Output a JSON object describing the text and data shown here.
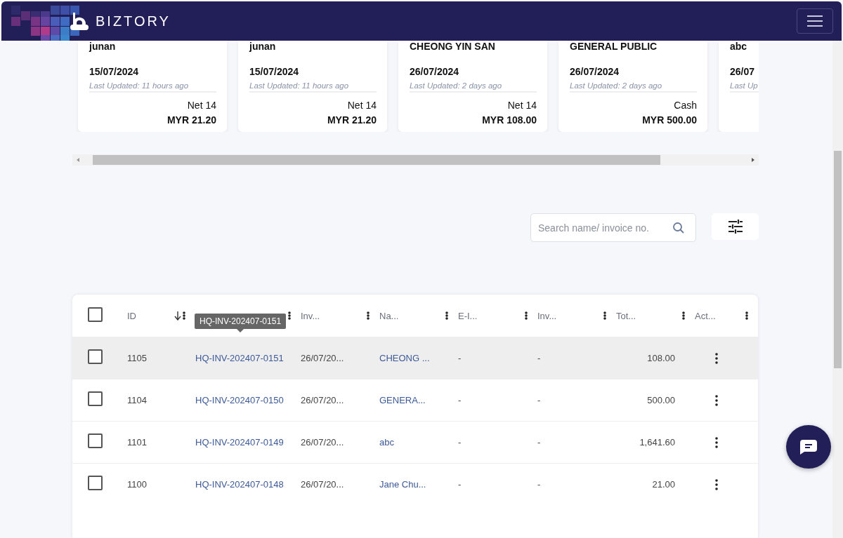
{
  "header": {
    "brand": "BIZTORY"
  },
  "cards": [
    {
      "name": "junan",
      "date": "15/07/2024",
      "updated": "Last Updated: 11 hours ago",
      "terms": "Net 14",
      "amount": "MYR 21.20"
    },
    {
      "name": "junan",
      "date": "15/07/2024",
      "updated": "Last Updated: 11 hours ago",
      "terms": "Net 14",
      "amount": "MYR 21.20"
    },
    {
      "name": "CHEONG YIN SAN",
      "date": "26/07/2024",
      "updated": "Last Updated: 2 days ago",
      "terms": "Net 14",
      "amount": "MYR 108.00"
    },
    {
      "name": "GENERAL PUBLIC",
      "date": "26/07/2024",
      "updated": "Last Updated: 2 days ago",
      "terms": "Cash",
      "amount": "MYR 500.00"
    },
    {
      "name": "abc",
      "date": "26/07",
      "updated": "Last Up"
    }
  ],
  "search": {
    "placeholder": "Search name/ invoice no."
  },
  "table": {
    "all_checked": false,
    "columns": [
      {
        "label": "ID",
        "kind": "sorted"
      },
      {
        "kind": "plain"
      },
      {
        "label": "Inv...",
        "kind": "plain"
      },
      {
        "label": "Na...",
        "kind": "plain"
      },
      {
        "label": "E-I...",
        "kind": "plain"
      },
      {
        "label": "Inv...",
        "kind": "plain"
      },
      {
        "label": "Tot...",
        "kind": "plain"
      },
      {
        "label": "Act...",
        "kind": "plain"
      }
    ],
    "tooltip": "HQ-INV-202407-0151",
    "rows": [
      {
        "id": "1105",
        "ref": "HQ-INV-202407-0151",
        "date": "26/07/20...",
        "name": "CHEONG ...",
        "einvoice": "-",
        "status": "-",
        "total": "108.00",
        "checked": false,
        "selected": true
      },
      {
        "id": "1104",
        "ref": "HQ-INV-202407-0150",
        "date": "26/07/20...",
        "name": "GENERA...",
        "einvoice": "-",
        "status": "-",
        "total": "500.00",
        "checked": false,
        "selected": false
      },
      {
        "id": "1101",
        "ref": "HQ-INV-202407-0149",
        "date": "26/07/20...",
        "name": "abc",
        "einvoice": "-",
        "status": "-",
        "total": "1,641.60",
        "checked": false,
        "selected": false
      },
      {
        "id": "1100",
        "ref": "HQ-INV-202407-0148",
        "date": "26/07/20...",
        "name": "Jane Chu...",
        "einvoice": "-",
        "status": "-",
        "total": "21.00",
        "checked": false,
        "selected": false
      }
    ]
  }
}
